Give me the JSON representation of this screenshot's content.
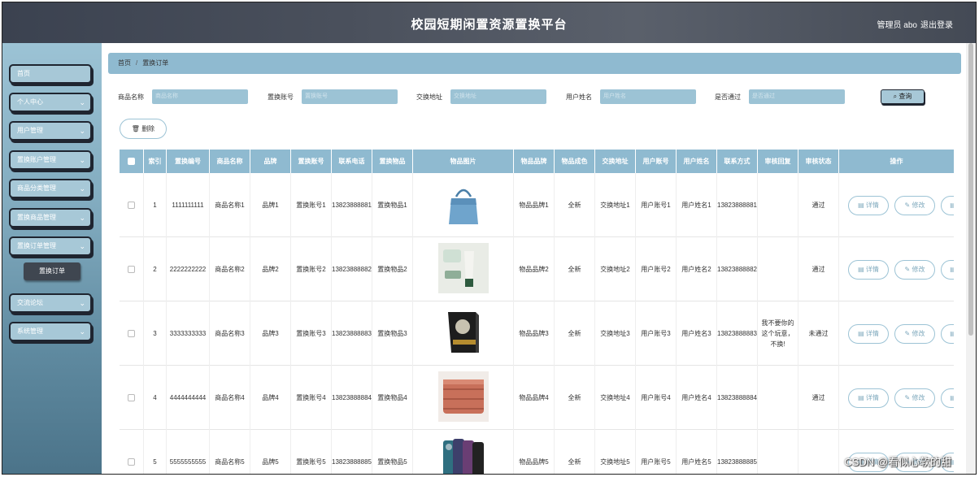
{
  "header": {
    "title": "校园短期闲置资源置换平台",
    "admin": "管理员 abo",
    "logout": "退出登录"
  },
  "sidebar": {
    "items": [
      {
        "label": "首页",
        "has_chevron": false
      },
      {
        "label": "个人中心",
        "has_chevron": true
      },
      {
        "label": "用户管理",
        "has_chevron": true
      },
      {
        "label": "置换账户管理",
        "has_chevron": true
      },
      {
        "label": "商品分类管理",
        "has_chevron": true
      },
      {
        "label": "置换商品管理",
        "has_chevron": true
      },
      {
        "label": "置换订单管理",
        "has_chevron": true
      },
      {
        "label": "交流论坛",
        "has_chevron": true
      },
      {
        "label": "系统管理",
        "has_chevron": true
      }
    ],
    "sub_item": "置换订单"
  },
  "breadcrumb": {
    "home": "首页",
    "sep": "/",
    "current": "置换订单"
  },
  "search": {
    "fields": [
      {
        "label": "商品名称",
        "placeholder": "商品名称"
      },
      {
        "label": "置换账号",
        "placeholder": "置换账号"
      },
      {
        "label": "交换地址",
        "placeholder": "交换地址"
      },
      {
        "label": "用户姓名",
        "placeholder": "用户姓名"
      },
      {
        "label": "是否通过",
        "placeholder": "是否通过"
      }
    ],
    "query_label": "查询",
    "query_icon": "search-icon"
  },
  "delete_label": "删除",
  "delete_icon": "trash-icon",
  "table": {
    "columns": [
      "索引",
      "置换编号",
      "商品名称",
      "品牌",
      "置换账号",
      "联系电话",
      "置换物品",
      "物品图片",
      "物品品牌",
      "物品成色",
      "交换地址",
      "用户账号",
      "用户姓名",
      "联系方式",
      "审核回复",
      "审核状态",
      "操作"
    ],
    "rows": [
      {
        "index": "1",
        "code": "1111111111",
        "name": "商品名称1",
        "brand": "品牌1",
        "account": "置换账号1",
        "phone": "13823888881",
        "item": "置换物品1",
        "image": "handbag",
        "item_brand": "物品品牌1",
        "condition": "全新",
        "address": "交换地址1",
        "user_acc": "用户账号1",
        "user_name": "用户姓名1",
        "contact": "13823888881",
        "reply": "",
        "status": "通过"
      },
      {
        "index": "2",
        "code": "2222222222",
        "name": "商品名称2",
        "brand": "品牌2",
        "account": "置换账号2",
        "phone": "13823888882",
        "item": "置换物品2",
        "image": "cosmetics",
        "item_brand": "物品品牌2",
        "condition": "全新",
        "address": "交换地址2",
        "user_acc": "用户账号2",
        "user_name": "用户姓名2",
        "contact": "13823888882",
        "reply": "",
        "status": "通过"
      },
      {
        "index": "3",
        "code": "3333333333",
        "name": "商品名称3",
        "brand": "品牌3",
        "account": "置换账号3",
        "phone": "13823888883",
        "item": "置换物品3",
        "image": "book",
        "item_brand": "物品品牌3",
        "condition": "全新",
        "address": "交换地址3",
        "user_acc": "用户账号3",
        "user_name": "用户姓名3",
        "contact": "13823888883",
        "reply": "我不要你的这个玩意，不换!",
        "status": "未通过"
      },
      {
        "index": "4",
        "code": "4444444444",
        "name": "商品名称4",
        "brand": "品牌4",
        "account": "置换账号4",
        "phone": "13823888884",
        "item": "置换物品4",
        "image": "blanket",
        "item_brand": "物品品牌4",
        "condition": "全新",
        "address": "交换地址4",
        "user_acc": "用户账号4",
        "user_name": "用户姓名4",
        "contact": "13823888884",
        "reply": "",
        "status": "通过"
      },
      {
        "index": "5",
        "code": "5555555555",
        "name": "商品名称5",
        "brand": "品牌5",
        "account": "置换账号5",
        "phone": "13823888885",
        "item": "置换物品5",
        "image": "phones",
        "item_brand": "物品品牌5",
        "condition": "全新",
        "address": "交换地址5",
        "user_acc": "用户账号5",
        "user_name": "用户姓名5",
        "contact": "13823888885",
        "reply": "",
        "status": ""
      }
    ],
    "action_detail": "详情",
    "action_edit": "修改"
  },
  "watermark": "CSDN @看似心软的甜",
  "colors": {
    "accent": "#8fbad0",
    "sidebar": "#7fa9bd",
    "header": "#444a55"
  }
}
